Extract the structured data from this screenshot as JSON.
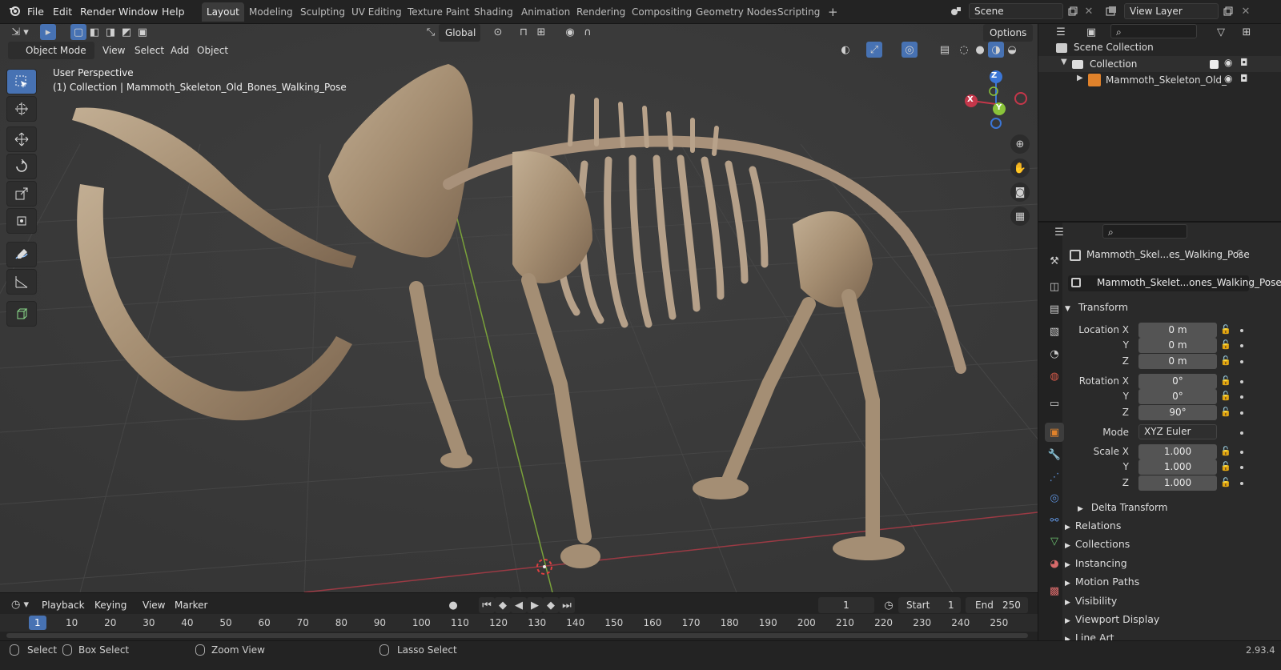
{
  "menus": [
    "File",
    "Edit",
    "Render",
    "Window",
    "Help"
  ],
  "workspaces": [
    "Layout",
    "Modeling",
    "Sculpting",
    "UV Editing",
    "Texture Paint",
    "Shading",
    "Animation",
    "Rendering",
    "Compositing",
    "Geometry Nodes",
    "Scripting"
  ],
  "active_workspace": "Layout",
  "scene_name": "Scene",
  "view_layer_name": "View Layer",
  "header": {
    "transform_orientation": "Global",
    "options_label": "Options"
  },
  "viewport": {
    "mode": "Object Mode",
    "menu_view": "View",
    "menu_select": "Select",
    "menu_add": "Add",
    "menu_object": "Object",
    "overlay_line1": "User Perspective",
    "overlay_line2": "(1) Collection | Mammoth_Skeleton_Old_Bones_Walking_Pose",
    "gizmo_x": "X",
    "gizmo_y": "Y",
    "gizmo_z": "Z"
  },
  "outliner": {
    "root": "Scene Collection",
    "collection": "Collection",
    "object": "Mammoth_Skeleton_Old_"
  },
  "properties": {
    "object_name": "Mammoth_Skel...es_Walking_Pose",
    "datablock_name": "Mammoth_Skelet...ones_Walking_Pose",
    "transform_title": "Transform",
    "location_label": "Location X",
    "rotation_label": "Rotation X",
    "scale_label": "Scale X",
    "y_label": "Y",
    "z_label": "Z",
    "location": [
      "0 m",
      "0 m",
      "0 m"
    ],
    "rotation": [
      "0°",
      "0°",
      "90°"
    ],
    "mode_label": "Mode",
    "mode_value": "XYZ Euler",
    "scale": [
      "1.000",
      "1.000",
      "1.000"
    ],
    "delta_transform": "Delta Transform",
    "sections": [
      "Relations",
      "Collections",
      "Instancing",
      "Motion Paths",
      "Visibility",
      "Viewport Display",
      "Line Art"
    ]
  },
  "timeline": {
    "playback": "Playback",
    "keying": "Keying",
    "view": "View",
    "marker": "Marker",
    "current_frame": "1",
    "start_label": "Start",
    "start_value": "1",
    "end_label": "End",
    "end_value": "250",
    "ruler": [
      "1",
      "10",
      "20",
      "30",
      "40",
      "50",
      "60",
      "70",
      "80",
      "90",
      "100",
      "110",
      "120",
      "130",
      "140",
      "150",
      "160",
      "170",
      "180",
      "190",
      "200",
      "210",
      "220",
      "230",
      "240",
      "250"
    ]
  },
  "status": {
    "select": "Select",
    "box_select": "Box Select",
    "zoom_view": "Zoom View",
    "lasso_select": "Lasso Select",
    "version": "2.93.4"
  },
  "colors": {
    "accent": "#4772b3",
    "x_axis": "#c4374a",
    "y_axis": "#8ac43a",
    "z_axis": "#3b76d6",
    "object_orange": "#e0822b",
    "bone": "#a89276"
  }
}
